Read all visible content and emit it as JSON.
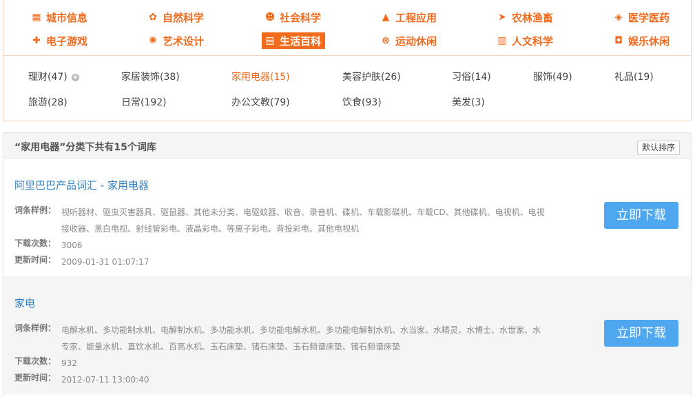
{
  "categories": [
    {
      "label": "城市信息",
      "icon": "building-icon",
      "glyph": "▦"
    },
    {
      "label": "自然科学",
      "icon": "leaf-icon",
      "glyph": "✿"
    },
    {
      "label": "社会科学",
      "icon": "people-icon",
      "glyph": "☻"
    },
    {
      "label": "工程应用",
      "icon": "rocket-icon",
      "glyph": "▲"
    },
    {
      "label": "农林渔畜",
      "icon": "fish-icon",
      "glyph": "➤"
    },
    {
      "label": "医学医药",
      "icon": "pill-icon",
      "glyph": "◈"
    },
    {
      "label": "电子游戏",
      "icon": "gamepad-icon",
      "glyph": "✚"
    },
    {
      "label": "艺术设计",
      "icon": "palette-icon",
      "glyph": "✺"
    },
    {
      "label": "生活百科",
      "icon": "basket-icon",
      "glyph": "▤"
    },
    {
      "label": "运动休闲",
      "icon": "ball-icon",
      "glyph": "⊛"
    },
    {
      "label": "人文科学",
      "icon": "book-icon",
      "glyph": "▥"
    },
    {
      "label": "娱乐休闲",
      "icon": "cup-icon",
      "glyph": "◘"
    }
  ],
  "active_category": "生活百科",
  "subcategories": [
    {
      "label": "理财(47)"
    },
    {
      "label": "家居装饰(38)"
    },
    {
      "label": "家用电器(15)"
    },
    {
      "label": "美容护肤(26)"
    },
    {
      "label": "习俗(14)"
    },
    {
      "label": "服饰(49)"
    },
    {
      "label": "礼品(19)"
    },
    {
      "label": "旅游(28)"
    },
    {
      "label": "日常(192)"
    },
    {
      "label": "办公文教(79)"
    },
    {
      "label": "饮食(93)"
    },
    {
      "label": "美发(3)"
    }
  ],
  "active_subcategory": "家用电器(15)",
  "list": {
    "title": "“家用电器”分类下共有15个词库",
    "sort_label": "默认排序",
    "label_examples": "词条样例：",
    "label_downloads": "下载次数：",
    "label_updated": "更新时间：",
    "download_label": "立即下载",
    "items": [
      {
        "name": "阿里巴巴产品词汇 - 家用电器",
        "examples_line1": "视听器材、驱虫灭害器具、驱鼠器、其他未分类、电驱蚊器、收音、录音机、碟机、车载影碟机、车载CD、其他碟机、电视机、电视",
        "examples_line2": "接收器、黑白电视、射线管彩电、液晶彩电、等离子彩电、背投彩电、其他电视机",
        "downloads": "3006",
        "updated": "2009-01-31 01:07:17"
      },
      {
        "name": "家电",
        "examples_line1": "电解水机、多功能制水机、电解制水机、多功能水机、多功能电解水机、多功能电解制水机、水当家、水精灵、水博士、水世家、水",
        "examples_line2": "专家、能量水机、直饮水机、百高水机、玉石床垫、锗石床垫、玉石频谱床垫、锗石频谱床垫",
        "downloads": "932",
        "updated": "2012-07-11 13:00:40"
      }
    ]
  },
  "colors": {
    "accent": "#f06a1d",
    "link": "#2e7fc2",
    "button": "#4fa8ef"
  }
}
